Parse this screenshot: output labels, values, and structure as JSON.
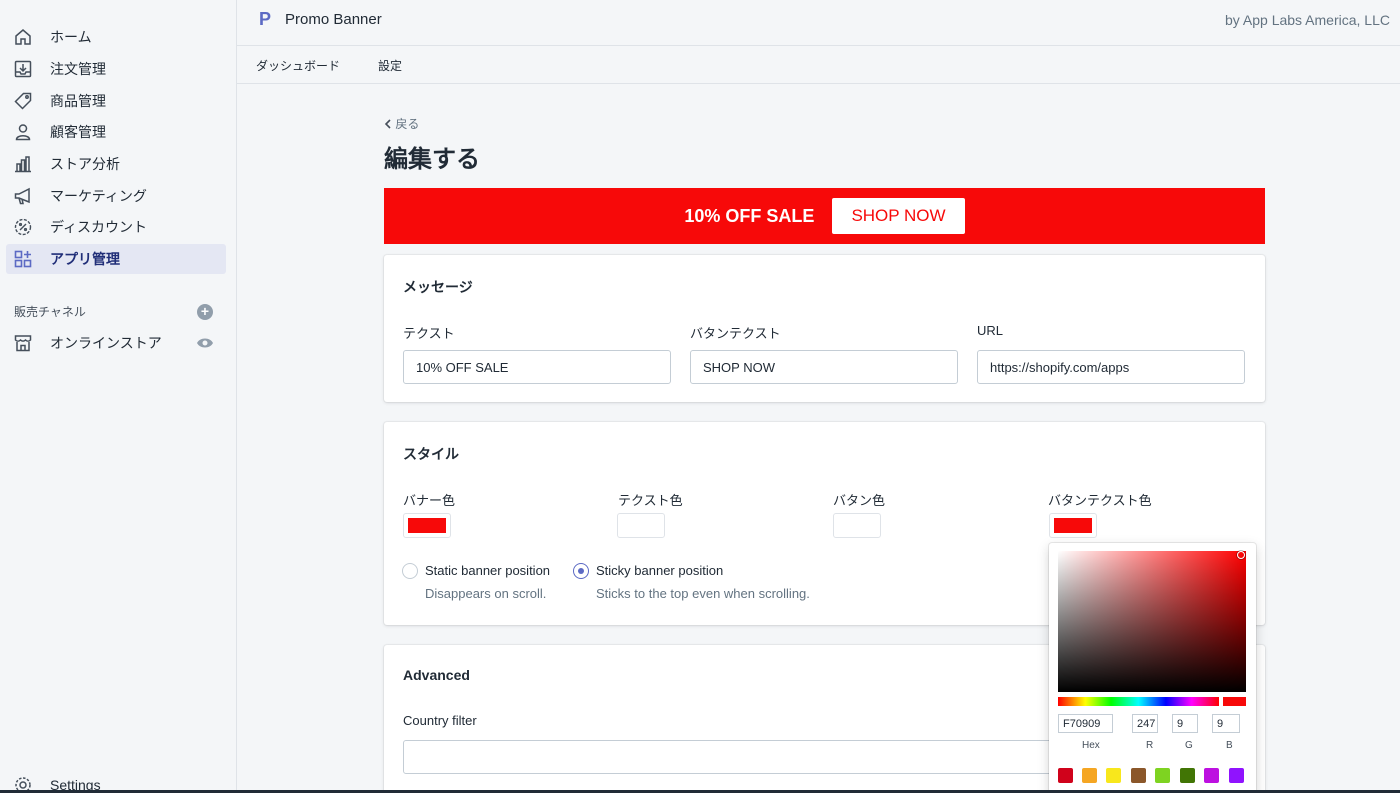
{
  "sidebar": {
    "items": [
      {
        "label": "ホーム",
        "icon": "home-icon"
      },
      {
        "label": "注文管理",
        "icon": "orders-icon"
      },
      {
        "label": "商品管理",
        "icon": "tag-icon"
      },
      {
        "label": "顧客管理",
        "icon": "customer-icon"
      },
      {
        "label": "ストア分析",
        "icon": "analytics-icon"
      },
      {
        "label": "マーケティング",
        "icon": "megaphone-icon"
      },
      {
        "label": "ディスカウント",
        "icon": "discount-icon"
      },
      {
        "label": "アプリ管理",
        "icon": "apps-icon",
        "active": true
      }
    ],
    "channels_label": "販売チャネル",
    "online_store_label": "オンラインストア",
    "settings_label": "Settings"
  },
  "header": {
    "logo_letter": "P",
    "app_title": "Promo Banner",
    "byline": "by App Labs America, LLC",
    "tabs": [
      "ダッシュボード",
      "設定"
    ]
  },
  "page": {
    "back_label": "戻る",
    "title": "編集する"
  },
  "preview": {
    "text": "10% OFF SALE",
    "button": "SHOP NOW",
    "banner_color": "#F70909",
    "text_color": "#FFFFFF",
    "button_color": "#FFFFFF",
    "button_text_color": "#F70909"
  },
  "message_card": {
    "title": "メッセージ",
    "text_label": "テクスト",
    "text_value": "10% OFF SALE",
    "button_text_label": "バタンテクスト",
    "button_text_value": "SHOP NOW",
    "url_label": "URL",
    "url_value": "https://shopify.com/apps"
  },
  "style_card": {
    "title": "スタイル",
    "banner_color_label": "バナー色",
    "text_color_label": "テクスト色",
    "button_color_label": "バタン色",
    "button_text_color_label": "バタンテクスト色",
    "static_label": "Static banner position",
    "static_help": "Disappears on scroll.",
    "sticky_label": "Sticky banner position",
    "sticky_help": "Sticks to the top even when scrolling.",
    "selected_position": "sticky"
  },
  "advanced_card": {
    "title": "Advanced",
    "country_filter_label": "Country filter",
    "country_filter_value": ""
  },
  "color_picker": {
    "hex": "F70909",
    "r": "247",
    "g": "9",
    "b": "9",
    "hex_label": "Hex",
    "r_label": "R",
    "g_label": "G",
    "b_label": "B",
    "presets": [
      "#D0021B",
      "#F5A623",
      "#F8E71C",
      "#8B572A",
      "#7ED321",
      "#417505",
      "#BD10E0",
      "#9013FE"
    ]
  }
}
